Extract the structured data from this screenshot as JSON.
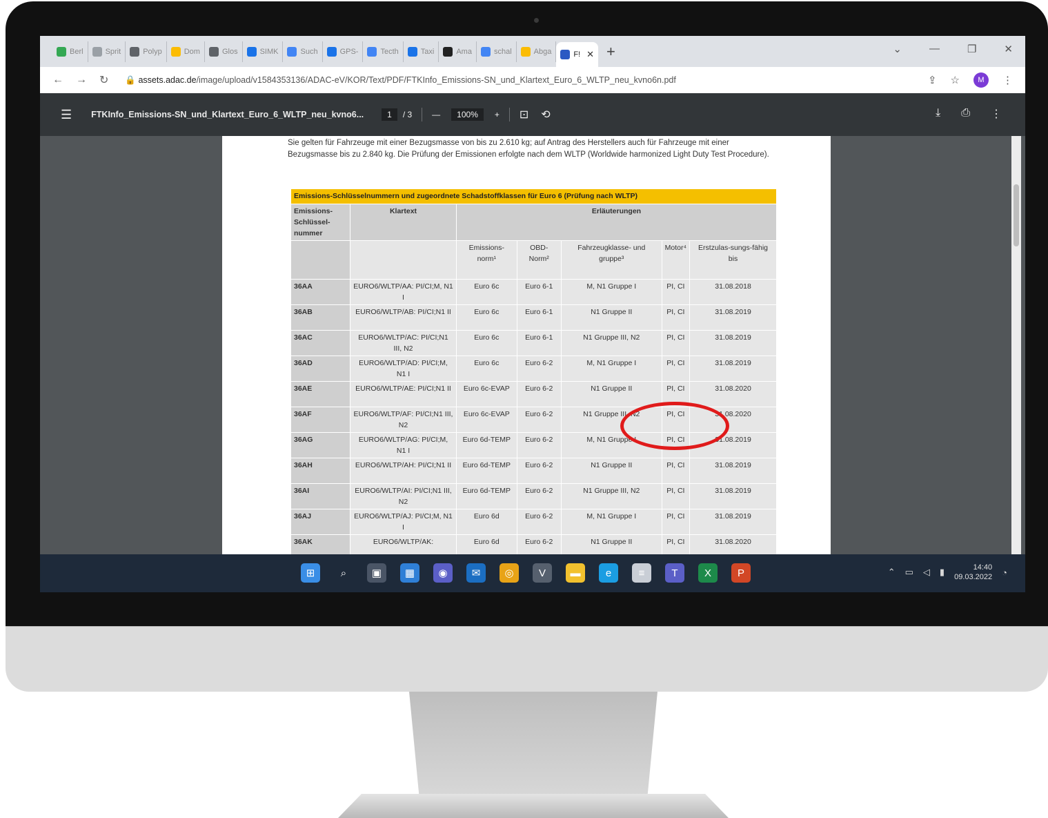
{
  "browser": {
    "tabs": [
      {
        "label": "Berl",
        "color": "#34a853"
      },
      {
        "label": "Sprit",
        "color": "#9aa0a6"
      },
      {
        "label": "Polyp",
        "color": "#5f6368"
      },
      {
        "label": "Dom",
        "color": "#fbbc04"
      },
      {
        "label": "Glos",
        "color": "#5f6368"
      },
      {
        "label": "SIMK",
        "color": "#1a73e8"
      },
      {
        "label": "Such",
        "color": "#4285f4"
      },
      {
        "label": "GPS-",
        "color": "#1a73e8"
      },
      {
        "label": "Tecth",
        "color": "#4285f4"
      },
      {
        "label": "Taxi",
        "color": "#1a73e8"
      },
      {
        "label": "Ama",
        "color": "#222222"
      },
      {
        "label": "schal",
        "color": "#4285f4"
      },
      {
        "label": "Abga",
        "color": "#fbbc04"
      }
    ],
    "active_tab": {
      "label": "F!",
      "close": "✕"
    },
    "new_tab": "+",
    "window_controls": [
      "⌄",
      "—",
      "❐",
      "✕"
    ],
    "url_host": "assets.adac.de",
    "url_path": "/image/upload/v1584353136/ADAC-eV/KOR/Text/PDF/FTKInfo_Emissions-SN_und_Klartext_Euro_6_WLTP_neu_kvno6n.pdf",
    "avatar_letter": "M"
  },
  "pdf": {
    "title": "FTKInfo_Emissions-SN_und_Klartext_Euro_6_WLTP_neu_kvno6...",
    "page_current": "1",
    "page_total": "/ 3",
    "zoom": "100%",
    "intro": "Sie gelten für Fahrzeuge mit einer Bezugsmasse von bis zu 2.610 kg; auf Antrag des Herstellers auch für Fahrzeuge mit einer Bezugsmasse bis zu 2.840 kg. Die Prüfung der Emissionen erfolgte nach dem WLTP (Worldwide harmonized Light Duty Test Procedure).",
    "table_caption": "Emissions-Schlüsselnummern und zugeordnete Schadstoffklassen für Euro 6 (Prüfung nach WLTP)",
    "head": {
      "sn": "Emissions-Schlüssel-nummer",
      "klartext": "Klartext",
      "erlaeuterungen": "Erläuterungen",
      "norm": "Emissions-norm¹",
      "obd": "OBD-Norm²",
      "klasse": "Fahrzeugklasse- und gruppe³",
      "motor": "Motor⁴",
      "erstzul": "Erstzulas-sungs-fähig bis"
    },
    "rows": [
      {
        "sn": "36AA",
        "kt": "EURO6/WLTP/AA: PI/CI;M, N1 I",
        "norm": "Euro 6c",
        "obd": "Euro 6-1",
        "klasse": "M, N1 Gruppe I",
        "motor": "PI, CI",
        "bis": "31.08.2018"
      },
      {
        "sn": "36AB",
        "kt": "EURO6/WLTP/AB: PI/CI;N1 II",
        "norm": "Euro 6c",
        "obd": "Euro 6-1",
        "klasse": "N1 Gruppe II",
        "motor": "PI, CI",
        "bis": "31.08.2019"
      },
      {
        "sn": "36AC",
        "kt": "EURO6/WLTP/AC: PI/CI;N1 III, N2",
        "norm": "Euro 6c",
        "obd": "Euro 6-1",
        "klasse": "N1 Gruppe III, N2",
        "motor": "PI, CI",
        "bis": "31.08.2019"
      },
      {
        "sn": "36AD",
        "kt": "EURO6/WLTP/AD: PI/CI;M, N1 I",
        "norm": "Euro 6c",
        "obd": "Euro 6-2",
        "klasse": "M, N1 Gruppe I",
        "motor": "PI, CI",
        "bis": "31.08.2019"
      },
      {
        "sn": "36AE",
        "kt": "EURO6/WLTP/AE: PI/CI;N1 II",
        "norm": "Euro 6c-EVAP",
        "obd": "Euro 6-2",
        "klasse": "N1 Gruppe II",
        "motor": "PI, CI",
        "bis": "31.08.2020"
      },
      {
        "sn": "36AF",
        "kt": "EURO6/WLTP/AF: PI/CI;N1 III, N2",
        "norm": "Euro 6c-EVAP",
        "obd": "Euro 6-2",
        "klasse": "N1 Gruppe III, N2",
        "motor": "PI, CI",
        "bis": "31.08.2020"
      },
      {
        "sn": "36AG",
        "kt": "EURO6/WLTP/AG: PI/CI;M, N1 I",
        "norm": "Euro 6d-TEMP",
        "obd": "Euro 6-2",
        "klasse": "M, N1 Gruppe I",
        "motor": "PI, CI",
        "bis": "31.08.2019"
      },
      {
        "sn": "36AH",
        "kt": "EURO6/WLTP/AH: PI/CI;N1 II",
        "norm": "Euro 6d-TEMP",
        "obd": "Euro 6-2",
        "klasse": "N1 Gruppe II",
        "motor": "PI, CI",
        "bis": "31.08.2019"
      },
      {
        "sn": "36AI",
        "kt": "EURO6/WLTP/AI: PI/CI;N1 III, N2",
        "norm": "Euro 6d-TEMP",
        "obd": "Euro 6-2",
        "klasse": "N1 Gruppe III, N2",
        "motor": "PI, CI",
        "bis": "31.08.2019"
      },
      {
        "sn": "36AJ",
        "kt": "EURO6/WLTP/AJ: PI/CI;M, N1 I",
        "norm": "Euro 6d",
        "obd": "Euro 6-2",
        "klasse": "M, N1 Gruppe I",
        "motor": "PI, CI",
        "bis": "31.08.2019"
      },
      {
        "sn": "36AK",
        "kt": "EURO6/WLTP/AK:",
        "norm": "Euro 6d",
        "obd": "Euro 6-2",
        "klasse": "N1 Gruppe II",
        "motor": "PI, CI",
        "bis": "31.08.2020"
      }
    ]
  },
  "taskbar": {
    "icons": [
      {
        "name": "start-icon",
        "glyph": "⊞",
        "color": "#3a8ee6"
      },
      {
        "name": "search-icon",
        "glyph": "⌕",
        "color": "#1e2a3a"
      },
      {
        "name": "task-view-icon",
        "glyph": "▣",
        "color": "#4a5566"
      },
      {
        "name": "widgets-icon",
        "glyph": "▦",
        "color": "#2f7fd6"
      },
      {
        "name": "teams-chat-icon",
        "glyph": "◉",
        "color": "#5b5fc7"
      },
      {
        "name": "outlook-icon",
        "glyph": "✉",
        "color": "#1b6ec2"
      },
      {
        "name": "chrome-icon",
        "glyph": "◎",
        "color": "#e8a317"
      },
      {
        "name": "vpn-icon",
        "glyph": "V",
        "color": "#56606e"
      },
      {
        "name": "file-explorer-icon",
        "glyph": "▬",
        "color": "#f2c12e"
      },
      {
        "name": "edge-icon",
        "glyph": "e",
        "color": "#1b9de2"
      },
      {
        "name": "notepad-icon",
        "glyph": "≡",
        "color": "#c9ced6"
      },
      {
        "name": "teams-icon",
        "glyph": "T",
        "color": "#5b5fc7"
      },
      {
        "name": "excel-icon",
        "glyph": "X",
        "color": "#1d8a4a"
      },
      {
        "name": "powerpoint-icon",
        "glyph": "P",
        "color": "#d24726"
      }
    ],
    "time": "14:40",
    "date": "09.03.2022"
  }
}
